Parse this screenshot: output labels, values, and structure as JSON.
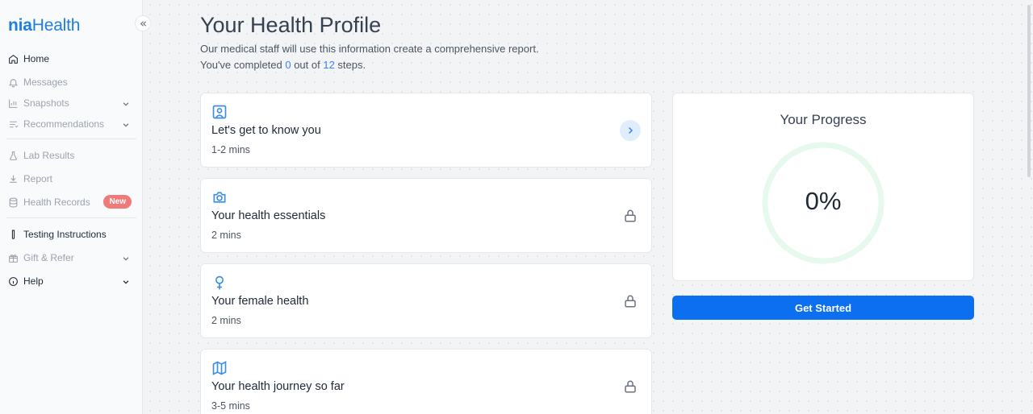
{
  "app": {
    "logo_bold": "nia",
    "logo_rest": "Health"
  },
  "sidebar": {
    "items": [
      {
        "label": "Home",
        "icon": "home-icon",
        "active": true
      },
      {
        "label": "Messages",
        "icon": "bell-icon"
      },
      {
        "label": "Snapshots",
        "icon": "bar-chart-icon",
        "expandable": true
      },
      {
        "label": "Recommendations",
        "icon": "list-icon",
        "expandable": true
      },
      {
        "label": "Lab Results",
        "icon": "flask-icon"
      },
      {
        "label": "Report",
        "icon": "download-icon"
      },
      {
        "label": "Health Records",
        "icon": "database-icon",
        "badge": "New"
      },
      {
        "label": "Testing Instructions",
        "icon": "test-tube-icon",
        "active": true
      },
      {
        "label": "Gift & Refer",
        "icon": "gift-icon",
        "expandable": true
      },
      {
        "label": "Help",
        "icon": "info-icon",
        "active": true,
        "expandable": true
      }
    ]
  },
  "main": {
    "title": "Your Health Profile",
    "subtitle": "Our medical staff will use this information create a comprehensive report.",
    "progress_prefix": "You've completed ",
    "completed": "0",
    "progress_middle": " out of ",
    "total": "12",
    "progress_suffix": " steps."
  },
  "cards": [
    {
      "title": "Let's get to know you",
      "time": "1-2 mins",
      "icon": "profile-icon",
      "status": "available"
    },
    {
      "title": "Your health essentials",
      "time": "2 mins",
      "icon": "camera-icon",
      "status": "locked"
    },
    {
      "title": "Your female health",
      "time": "2 mins",
      "icon": "female-icon",
      "status": "locked"
    },
    {
      "title": "Your health journey so far",
      "time": "3-5 mins",
      "icon": "map-icon",
      "status": "locked"
    }
  ],
  "progress": {
    "title": "Your Progress",
    "value_label": "0%",
    "value": 0,
    "button_label": "Get Started"
  },
  "colors": {
    "brand": "#1d7fe0",
    "accent_button": "#0b6ff0",
    "badge": "#f07a7a",
    "ring": "#e6f9ec"
  }
}
